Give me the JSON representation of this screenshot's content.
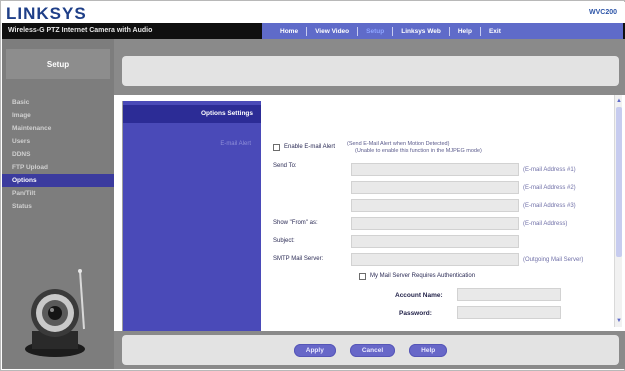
{
  "header": {
    "brand": "LINKSYS",
    "model": "WVC200",
    "product_name": "Wireless-G PTZ Internet Camera with Audio",
    "nav": [
      {
        "label": "Home",
        "active": false
      },
      {
        "label": "View Video",
        "active": false
      },
      {
        "label": "Setup",
        "active": true
      },
      {
        "label": "Linksys Web",
        "active": false
      },
      {
        "label": "Help",
        "active": false
      },
      {
        "label": "Exit",
        "active": false
      }
    ]
  },
  "sidebar": {
    "title": "Setup",
    "items": [
      {
        "label": "Basic",
        "active": false
      },
      {
        "label": "Image",
        "active": false
      },
      {
        "label": "Maintenance",
        "active": false
      },
      {
        "label": "Users",
        "active": false
      },
      {
        "label": "DDNS",
        "active": false
      },
      {
        "label": "FTP Upload",
        "active": false
      },
      {
        "label": "Options",
        "active": true
      },
      {
        "label": "Pan/Tilt",
        "active": false
      },
      {
        "label": "Status",
        "active": false
      }
    ]
  },
  "main": {
    "section_title": "Options Settings",
    "subsection_title": "E-mail Alert",
    "enable_checkbox_label": "Enable E-mail Alert",
    "enable_note_line1": "(Send E-Mail Alert when Motion Detected)",
    "enable_note_line2": "(Unable to enable this function in the MJPEG mode)",
    "send_to_label": "Send To:",
    "email_fields": [
      {
        "label": "(E-mail Address #1)",
        "value": ""
      },
      {
        "label": "(E-mail Address #2)",
        "value": ""
      },
      {
        "label": "(E-mail Address #3)",
        "value": ""
      }
    ],
    "show_from_label": "Show \"From\" as:",
    "show_from_hint": "(E-mail Address)",
    "subject_label": "Subject:",
    "smtp_label": "SMTP Mail Server:",
    "smtp_hint": "(Outgoing Mail Server)",
    "auth_checkbox_label": "My Mail Server Requires Authentication",
    "account_name_label": "Account Name:",
    "password_label": "Password:"
  },
  "footer": {
    "apply_label": "Apply",
    "cancel_label": "Cancel",
    "help_label": "Help"
  },
  "icons": {
    "scroll_up": "▲",
    "scroll_down": "▼"
  },
  "colors": {
    "accent": "#5f6bc9",
    "sidebar_active": "#3b3b9e",
    "section_bg": "#4a4ab8"
  }
}
